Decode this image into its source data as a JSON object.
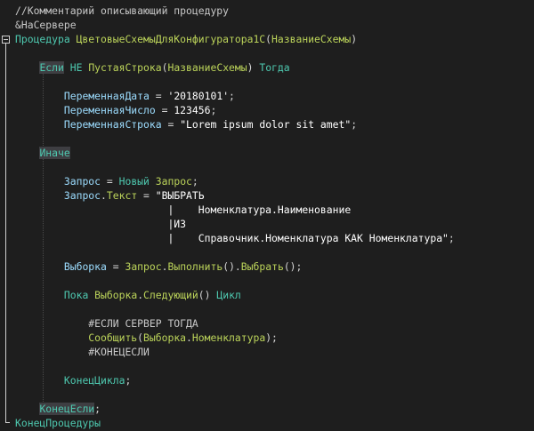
{
  "colors": {
    "background": "#1e1e1e",
    "comment": "#c8c8c8",
    "keyword": "#4ec9b0",
    "identifier": "#bcd45a",
    "variable": "#9cdcfe",
    "punctuation": "#d4d4d4",
    "string": "#ffffff",
    "number": "#ffffff",
    "plain": "#d4d4d4",
    "highlight": "#3e3e42"
  },
  "code": {
    "lines": [
      {
        "tokens": [
          {
            "t": "//Комментарий описывающий процедуру",
            "c": "comment"
          }
        ]
      },
      {
        "tokens": [
          {
            "t": "&НаСервере",
            "c": "comment"
          }
        ]
      },
      {
        "tokens": [
          {
            "t": "Процедура ",
            "c": "keyword"
          },
          {
            "t": "ЦветовыеСхемыДляКонфигуратора1С",
            "c": "identifier"
          },
          {
            "t": "(",
            "c": "punctuation"
          },
          {
            "t": "НазваниеСхемы",
            "c": "identifier"
          },
          {
            "t": ")",
            "c": "punctuation"
          }
        ]
      },
      {
        "tokens": []
      },
      {
        "tokens": [
          {
            "t": "    ",
            "c": "plain"
          },
          {
            "t": "Если",
            "c": "keyword",
            "hl": true
          },
          {
            "t": " НЕ ",
            "c": "keyword"
          },
          {
            "t": "ПустаяСтрока",
            "c": "identifier"
          },
          {
            "t": "(",
            "c": "punctuation"
          },
          {
            "t": "НазваниеСхемы",
            "c": "identifier"
          },
          {
            "t": ")",
            "c": "punctuation"
          },
          {
            "t": " Тогда",
            "c": "keyword"
          }
        ]
      },
      {
        "tokens": []
      },
      {
        "tokens": [
          {
            "t": "        ",
            "c": "plain"
          },
          {
            "t": "ПеременнаяДата",
            "c": "variable"
          },
          {
            "t": " = ",
            "c": "punctuation"
          },
          {
            "t": "'20180101'",
            "c": "string"
          },
          {
            "t": ";",
            "c": "punctuation"
          }
        ]
      },
      {
        "tokens": [
          {
            "t": "        ",
            "c": "plain"
          },
          {
            "t": "ПеременнаяЧисло",
            "c": "variable"
          },
          {
            "t": " = ",
            "c": "punctuation"
          },
          {
            "t": "123456",
            "c": "number"
          },
          {
            "t": ";",
            "c": "punctuation"
          }
        ]
      },
      {
        "tokens": [
          {
            "t": "        ",
            "c": "plain"
          },
          {
            "t": "ПеременнаяСтрока",
            "c": "variable"
          },
          {
            "t": " = ",
            "c": "punctuation"
          },
          {
            "t": "\"Lorem ipsum dolor sit amet\"",
            "c": "string"
          },
          {
            "t": ";",
            "c": "punctuation"
          }
        ]
      },
      {
        "tokens": []
      },
      {
        "tokens": [
          {
            "t": "    ",
            "c": "plain"
          },
          {
            "t": "Иначе",
            "c": "keyword",
            "hl": true
          }
        ]
      },
      {
        "tokens": []
      },
      {
        "tokens": [
          {
            "t": "        ",
            "c": "plain"
          },
          {
            "t": "Запрос",
            "c": "variable"
          },
          {
            "t": " = ",
            "c": "punctuation"
          },
          {
            "t": "Новый ",
            "c": "keyword"
          },
          {
            "t": "Запрос",
            "c": "identifier"
          },
          {
            "t": ";",
            "c": "punctuation"
          }
        ]
      },
      {
        "tokens": [
          {
            "t": "        ",
            "c": "plain"
          },
          {
            "t": "Запрос",
            "c": "variable"
          },
          {
            "t": ".",
            "c": "punctuation"
          },
          {
            "t": "Текст",
            "c": "identifier"
          },
          {
            "t": " = ",
            "c": "punctuation"
          },
          {
            "t": "\"ВЫБРАТЬ",
            "c": "string"
          }
        ]
      },
      {
        "tokens": [
          {
            "t": "                         ",
            "c": "plain"
          },
          {
            "t": "|    Номенклатура.Наименование",
            "c": "string"
          }
        ]
      },
      {
        "tokens": [
          {
            "t": "                         ",
            "c": "plain"
          },
          {
            "t": "|ИЗ",
            "c": "string"
          }
        ]
      },
      {
        "tokens": [
          {
            "t": "                         ",
            "c": "plain"
          },
          {
            "t": "|    Справочник.Номенклатура КАК Номенклатура\"",
            "c": "string"
          },
          {
            "t": ";",
            "c": "punctuation"
          }
        ]
      },
      {
        "tokens": []
      },
      {
        "tokens": [
          {
            "t": "        ",
            "c": "plain"
          },
          {
            "t": "Выборка",
            "c": "variable"
          },
          {
            "t": " = ",
            "c": "punctuation"
          },
          {
            "t": "Запрос",
            "c": "identifier"
          },
          {
            "t": ".",
            "c": "punctuation"
          },
          {
            "t": "Выполнить",
            "c": "identifier"
          },
          {
            "t": "().",
            "c": "punctuation"
          },
          {
            "t": "Выбрать",
            "c": "identifier"
          },
          {
            "t": "();",
            "c": "punctuation"
          }
        ]
      },
      {
        "tokens": []
      },
      {
        "tokens": [
          {
            "t": "        ",
            "c": "plain"
          },
          {
            "t": "Пока ",
            "c": "keyword"
          },
          {
            "t": "Выборка",
            "c": "identifier"
          },
          {
            "t": ".",
            "c": "punctuation"
          },
          {
            "t": "Следующий",
            "c": "identifier"
          },
          {
            "t": "()",
            "c": "punctuation"
          },
          {
            "t": " Цикл",
            "c": "keyword"
          }
        ]
      },
      {
        "tokens": []
      },
      {
        "tokens": [
          {
            "t": "            ",
            "c": "plain"
          },
          {
            "t": "#ЕСЛИ СЕРВЕР ТОГДА",
            "c": "comment"
          }
        ]
      },
      {
        "tokens": [
          {
            "t": "            ",
            "c": "plain"
          },
          {
            "t": "Сообщить",
            "c": "identifier"
          },
          {
            "t": "(",
            "c": "punctuation"
          },
          {
            "t": "Выборка",
            "c": "identifier"
          },
          {
            "t": ".",
            "c": "punctuation"
          },
          {
            "t": "Номенклатура",
            "c": "identifier"
          },
          {
            "t": ");",
            "c": "punctuation"
          }
        ]
      },
      {
        "tokens": [
          {
            "t": "            ",
            "c": "plain"
          },
          {
            "t": "#КОНЕЦЕСЛИ",
            "c": "comment"
          }
        ]
      },
      {
        "tokens": []
      },
      {
        "tokens": [
          {
            "t": "        ",
            "c": "plain"
          },
          {
            "t": "КонецЦикла",
            "c": "keyword"
          },
          {
            "t": ";",
            "c": "punctuation"
          }
        ]
      },
      {
        "tokens": []
      },
      {
        "tokens": [
          {
            "t": "    ",
            "c": "plain"
          },
          {
            "t": "КонецЕсли",
            "c": "keyword",
            "hl": true
          },
          {
            "t": ";",
            "c": "punctuation"
          }
        ]
      },
      {
        "tokens": [
          {
            "t": "КонецПроцедуры",
            "c": "keyword"
          }
        ]
      }
    ]
  }
}
